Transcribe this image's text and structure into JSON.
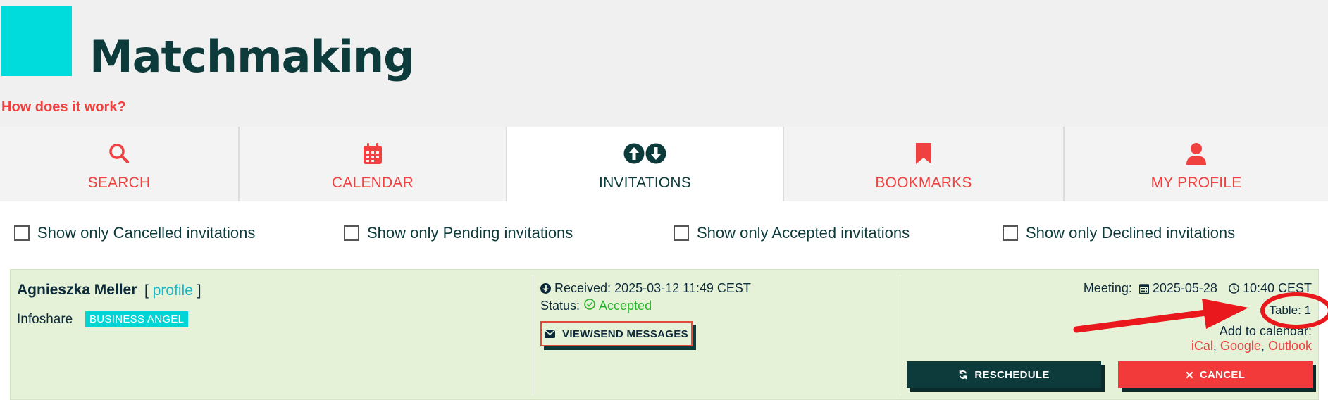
{
  "header": {
    "title": "Matchmaking",
    "how_link": "How does it work?"
  },
  "tabs": [
    {
      "label": "SEARCH",
      "icon": "search-icon",
      "active": false
    },
    {
      "label": "CALENDAR",
      "icon": "calendar-icon",
      "active": false
    },
    {
      "label": "INVITATIONS",
      "icon": "arrows-up-down-icon",
      "active": true
    },
    {
      "label": "BOOKMARKS",
      "icon": "bookmark-icon",
      "active": false
    },
    {
      "label": "MY PROFILE",
      "icon": "user-icon",
      "active": false
    }
  ],
  "filters": [
    {
      "label": "Show only Cancelled invitations",
      "checked": false
    },
    {
      "label": "Show only Pending invitations",
      "checked": false
    },
    {
      "label": "Show only Accepted invitations",
      "checked": false
    },
    {
      "label": "Show only Declined invitations",
      "checked": false
    }
  ],
  "invitation": {
    "name": "Agnieszka Meller",
    "profile_open": "[ ",
    "profile_link": "profile",
    "profile_close": " ]",
    "company": "Infoshare",
    "role_badge": "BUSINESS ANGEL",
    "received_label": "Received:",
    "received_value": "2025-03-12 11:49 CEST",
    "status_label": "Status:",
    "status_value": "Accepted",
    "messages_button": "VIEW/SEND MESSAGES",
    "meeting_label": "Meeting:",
    "meeting_date": "2025-05-28",
    "meeting_time": "10:40 CEST",
    "table_label": "Table: 1",
    "add_to_calendar_label": "Add to calendar:",
    "calendar_links": [
      "iCal",
      "Google",
      "Outlook"
    ],
    "reschedule_button": "RESCHEDULE",
    "cancel_button": "CANCEL"
  },
  "colors": {
    "accent_red": "#f04040",
    "dark_teal": "#0d3b3b",
    "brand_cyan": "#00dcdc",
    "card_green": "#e5f2d8",
    "status_green": "#2ab32a",
    "annotation_red": "#e8181c"
  }
}
